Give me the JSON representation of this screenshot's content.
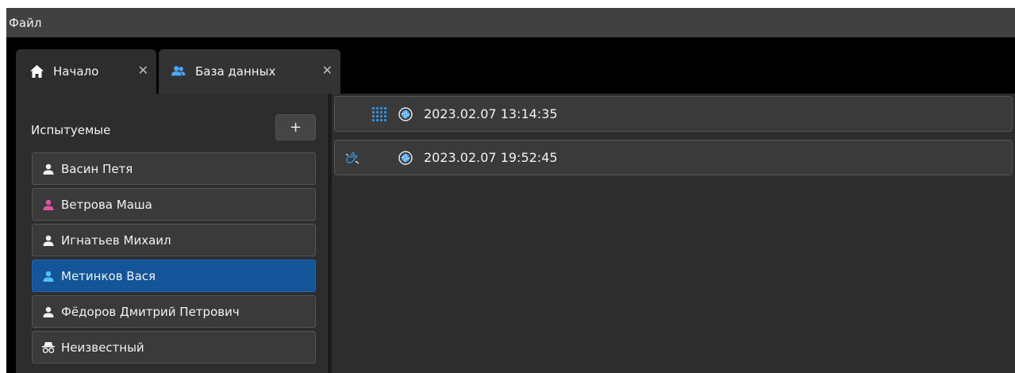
{
  "menu": {
    "file_label": "Файл"
  },
  "tabs": [
    {
      "label": "Начало",
      "icon": "home-icon",
      "close": "✕"
    },
    {
      "label": "База данных",
      "icon": "users-icon",
      "close": "✕"
    }
  ],
  "subjects_panel": {
    "title": "Испытуемые",
    "add_label": "+",
    "items": [
      {
        "label": "Васин Петя",
        "icon": "person-icon",
        "icon_color": "#f0f0f0"
      },
      {
        "label": "Ветрова Маша",
        "icon": "person-icon",
        "icon_color": "#e0559f"
      },
      {
        "label": "Игнатьев Михаил",
        "icon": "person-icon",
        "icon_color": "#f0f0f0"
      },
      {
        "label": "Метинков Вася",
        "icon": "person-icon",
        "icon_color": "#4fc3f7",
        "selected": true
      },
      {
        "label": "Фёдоров Дмитрий Петрович",
        "icon": "person-icon",
        "icon_color": "#f0f0f0"
      },
      {
        "label": "Неизвестный",
        "icon": "incognito-icon",
        "icon_color": "#f0f0f0"
      }
    ]
  },
  "sessions": [
    {
      "timestamp": "2023.02.07 13:14:35",
      "type_icon": "grid-icon",
      "status_icon": "aperture-icon"
    },
    {
      "timestamp": "2023.02.07 19:52:45",
      "type_icon": "gesture-icon",
      "status_icon": "aperture-icon"
    }
  ],
  "colors": {
    "accent_blue": "#14559a",
    "icon_blue": "#2f8fe0",
    "panel_bg": "#2d2d2d",
    "item_bg": "#3a3a3a"
  }
}
